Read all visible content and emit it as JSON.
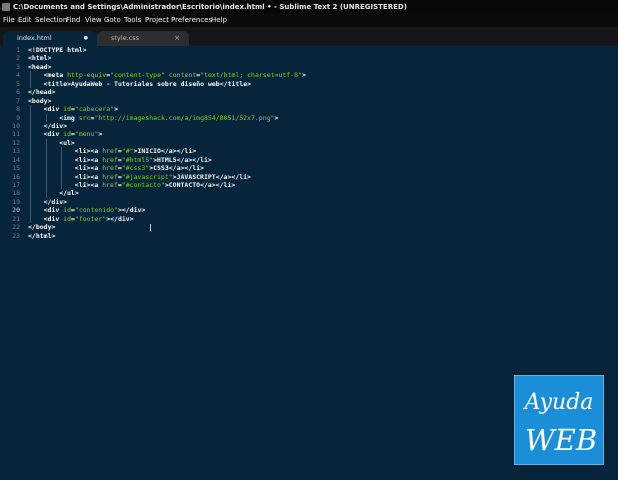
{
  "window": {
    "title": "C:\\Documents and Settings\\Administrador\\Escritorio\\index.html • - Sublime Text 2 (UNREGISTERED)"
  },
  "menu": [
    {
      "label": "File"
    },
    {
      "label": "Edit"
    },
    {
      "label": "Selection"
    },
    {
      "label": "Find"
    },
    {
      "label": "View"
    },
    {
      "label": "Goto"
    },
    {
      "label": "Tools"
    },
    {
      "label": "Project"
    },
    {
      "label": "Preferences"
    },
    {
      "label": "Help"
    }
  ],
  "tabs": [
    {
      "label": "index.html",
      "active": true,
      "modified_glyph": "●"
    },
    {
      "label": "style.css",
      "active": false,
      "close_glyph": "×"
    }
  ],
  "editor": {
    "current_line": 20,
    "lines": [
      {
        "n": "1",
        "indent": 0,
        "tokens": [
          [
            "p",
            "<!DOCTYPE html>"
          ]
        ]
      },
      {
        "n": "2",
        "indent": 0,
        "tokens": [
          [
            "p",
            "<html>"
          ]
        ]
      },
      {
        "n": "3",
        "indent": 0,
        "tokens": [
          [
            "p",
            "<head>"
          ]
        ]
      },
      {
        "n": "4",
        "indent": 1,
        "tokens": [
          [
            "p",
            "<meta "
          ],
          [
            "a",
            "http-equiv"
          ],
          [
            "p",
            "="
          ],
          [
            "s",
            "\"content-type\""
          ],
          [
            "p",
            " "
          ],
          [
            "a",
            "content"
          ],
          [
            "p",
            "="
          ],
          [
            "s",
            "\"text/html; charset=utf-8\""
          ],
          [
            "p",
            ">"
          ]
        ]
      },
      {
        "n": "5",
        "indent": 1,
        "tokens": [
          [
            "p",
            "<title>"
          ],
          [
            "t",
            "AyudaWeb - Tutoriales sobre diseño web"
          ],
          [
            "p",
            "</title>"
          ]
        ]
      },
      {
        "n": "6",
        "indent": 0,
        "tokens": [
          [
            "p",
            "</head>"
          ]
        ]
      },
      {
        "n": "7",
        "indent": 0,
        "tokens": [
          [
            "p",
            "<body>"
          ]
        ]
      },
      {
        "n": "8",
        "indent": 1,
        "tokens": [
          [
            "p",
            "<div "
          ],
          [
            "a",
            "id"
          ],
          [
            "p",
            "="
          ],
          [
            "s",
            "\"cabecera\""
          ],
          [
            "p",
            ">"
          ]
        ]
      },
      {
        "n": "9",
        "indent": 2,
        "tokens": [
          [
            "p",
            "<img "
          ],
          [
            "a",
            "src"
          ],
          [
            "p",
            "="
          ],
          [
            "s",
            "\"http://imageshack.com/a/img854/8051/52x7.png\""
          ],
          [
            "p",
            ">"
          ]
        ]
      },
      {
        "n": "10",
        "indent": 1,
        "tokens": [
          [
            "p",
            "</div>"
          ]
        ]
      },
      {
        "n": "11",
        "indent": 1,
        "tokens": [
          [
            "p",
            "<div "
          ],
          [
            "a",
            "id"
          ],
          [
            "p",
            "="
          ],
          [
            "s",
            "\"menu\""
          ],
          [
            "p",
            ">"
          ]
        ]
      },
      {
        "n": "12",
        "indent": 2,
        "tokens": [
          [
            "p",
            "<ul>"
          ]
        ]
      },
      {
        "n": "13",
        "indent": 3,
        "tokens": [
          [
            "p",
            "<li><a "
          ],
          [
            "a",
            "href"
          ],
          [
            "p",
            "="
          ],
          [
            "s",
            "\"#\""
          ],
          [
            "p",
            ">"
          ],
          [
            "t",
            "INICIO"
          ],
          [
            "p",
            "</a></li>"
          ]
        ]
      },
      {
        "n": "14",
        "indent": 3,
        "tokens": [
          [
            "p",
            "<li><a "
          ],
          [
            "a",
            "href"
          ],
          [
            "p",
            "="
          ],
          [
            "s",
            "\"#html5\""
          ],
          [
            "p",
            ">"
          ],
          [
            "t",
            "HTML5"
          ],
          [
            "p",
            "</a></li>"
          ]
        ]
      },
      {
        "n": "15",
        "indent": 3,
        "tokens": [
          [
            "p",
            "<li><a "
          ],
          [
            "a",
            "href"
          ],
          [
            "p",
            "="
          ],
          [
            "s",
            "\"#css3\""
          ],
          [
            "p",
            ">"
          ],
          [
            "t",
            "CSS3"
          ],
          [
            "p",
            "</a></li>"
          ]
        ]
      },
      {
        "n": "16",
        "indent": 3,
        "tokens": [
          [
            "p",
            "<li><a "
          ],
          [
            "a",
            "href"
          ],
          [
            "p",
            "="
          ],
          [
            "s",
            "\"#javascript\""
          ],
          [
            "p",
            ">"
          ],
          [
            "t",
            "JAVASCRIPT"
          ],
          [
            "p",
            "</a></li>"
          ]
        ]
      },
      {
        "n": "17",
        "indent": 3,
        "tokens": [
          [
            "p",
            "<li><a "
          ],
          [
            "a",
            "href"
          ],
          [
            "p",
            "="
          ],
          [
            "s",
            "\"#contacto\""
          ],
          [
            "p",
            ">"
          ],
          [
            "t",
            "CONTACTO"
          ],
          [
            "p",
            "</a></li>"
          ]
        ]
      },
      {
        "n": "18",
        "indent": 2,
        "tokens": [
          [
            "p",
            "</ul>"
          ]
        ]
      },
      {
        "n": "19",
        "indent": 1,
        "tokens": [
          [
            "p",
            "</div>"
          ]
        ]
      },
      {
        "n": "20",
        "indent": 1,
        "tokens": [
          [
            "p",
            "<div "
          ],
          [
            "a",
            "id"
          ],
          [
            "p",
            "="
          ],
          [
            "s",
            "\"contenido\""
          ],
          [
            "p",
            "></div>"
          ]
        ]
      },
      {
        "n": "21",
        "indent": 1,
        "tokens": [
          [
            "p",
            "<div "
          ],
          [
            "a",
            "id"
          ],
          [
            "p",
            "="
          ],
          [
            "s",
            "\"footer\""
          ],
          [
            "p",
            "></div>"
          ]
        ]
      },
      {
        "n": "22",
        "indent": 0,
        "tokens": [
          [
            "p",
            "</body>"
          ]
        ]
      },
      {
        "n": "23",
        "indent": 0,
        "tokens": [
          [
            "p",
            "</html>"
          ]
        ]
      }
    ]
  },
  "colors": {
    "background": "#06243a",
    "tag": "#f8f8f8",
    "attribute": "#9acd32",
    "string": "#7ed321",
    "text": "#f8f8f8",
    "logo": "#1a8fd8"
  },
  "logo": {
    "line1": "Ayuda",
    "line2": "WEB"
  }
}
